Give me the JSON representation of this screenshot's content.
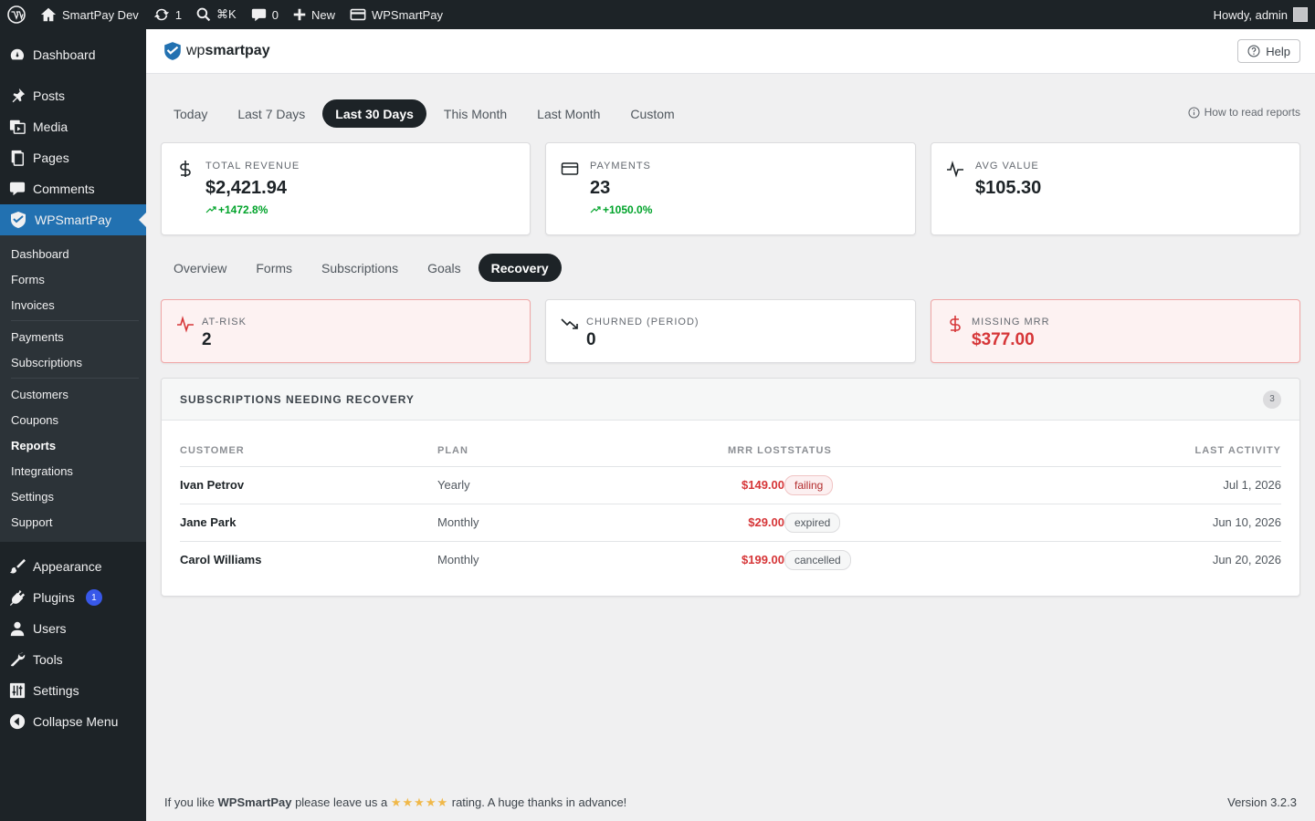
{
  "adminbar": {
    "site_name": "SmartPay Dev",
    "updates_count": "1",
    "search_shortcut": "⌘K",
    "comments_count": "0",
    "new_label": "New",
    "plugin_label": "WPSmartPay",
    "greeting": "Howdy, admin"
  },
  "sidebar": {
    "dashboard": "Dashboard",
    "posts": "Posts",
    "media": "Media",
    "pages": "Pages",
    "comments": "Comments",
    "wpsmartpay": "WPSmartPay",
    "submenu": {
      "dashboard": "Dashboard",
      "forms": "Forms",
      "invoices": "Invoices",
      "payments": "Payments",
      "subscriptions": "Subscriptions",
      "customers": "Customers",
      "coupons": "Coupons",
      "reports": "Reports",
      "integrations": "Integrations",
      "settings": "Settings",
      "support": "Support"
    },
    "appearance": "Appearance",
    "plugins": "Plugins",
    "plugins_badge": "1",
    "users": "Users",
    "tools": "Tools",
    "settings": "Settings",
    "collapse": "Collapse Menu"
  },
  "header": {
    "logo_prefix": "wp",
    "logo_brand": "smartpay",
    "help_label": "Help"
  },
  "range_tabs": {
    "today": "Today",
    "last7": "Last 7 Days",
    "last30": "Last 30 Days",
    "this_month": "This Month",
    "last_month": "Last Month",
    "custom": "Custom"
  },
  "how_to_read": "How to read reports",
  "stats": {
    "revenue": {
      "label": "TOTAL REVENUE",
      "value": "$2,421.94",
      "delta": "+1472.8%"
    },
    "payments": {
      "label": "PAYMENTS",
      "value": "23",
      "delta": "+1050.0%"
    },
    "avg": {
      "label": "AVG VALUE",
      "value": "$105.30"
    }
  },
  "report_tabs": {
    "overview": "Overview",
    "forms": "Forms",
    "subscriptions": "Subscriptions",
    "goals": "Goals",
    "recovery": "Recovery"
  },
  "recovery_cards": {
    "at_risk": {
      "label": "AT-RISK",
      "value": "2"
    },
    "churned": {
      "label": "CHURNED (PERIOD)",
      "value": "0"
    },
    "missing": {
      "label": "MISSING MRR",
      "value": "$377.00"
    }
  },
  "recovery_table": {
    "title": "SUBSCRIPTIONS NEEDING RECOVERY",
    "count": "3",
    "columns": {
      "customer": "CUSTOMER",
      "plan": "PLAN",
      "mrr_status": "MRR LOSTSTATUS",
      "last_activity": "LAST ACTIVITY"
    },
    "rows": [
      {
        "customer": "Ivan Petrov",
        "plan": "Yearly",
        "mrr": "$149.00",
        "status": "failing",
        "last": "Jul 1, 2026"
      },
      {
        "customer": "Jane Park",
        "plan": "Monthly",
        "mrr": "$29.00",
        "status": "expired",
        "last": "Jun 10, 2026"
      },
      {
        "customer": "Carol Williams",
        "plan": "Monthly",
        "mrr": "$199.00",
        "status": "cancelled",
        "last": "Jun 20, 2026"
      }
    ]
  },
  "footer": {
    "pre": "If you like ",
    "brand": "WPSmartPay",
    "mid": " please leave us a ",
    "stars": "★★★★★",
    "post": " rating. A huge thanks in advance!",
    "version": "Version 3.2.3"
  },
  "colors": {
    "accent": "#2271b1",
    "dark": "#1d2327",
    "danger": "#d63638",
    "success": "#00a32a"
  }
}
